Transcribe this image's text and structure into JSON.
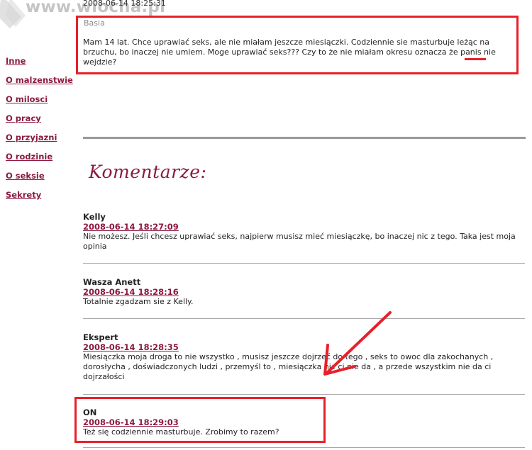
{
  "watermark": {
    "text": "www.wiocha.pl"
  },
  "post": {
    "date": "2008-06-14 18:25:31",
    "author": "Basia",
    "text": "Mam 14 lat. Chce uprawiać seks, ale nie miałam jeszcze miesiączki. Codziennie sie masturbuje leżąc na brzuchu, bo inaczej nie umiem. Moge uprawiać seks??? Czy to że nie miałam okresu oznacza że panis nie wejdzie?"
  },
  "sidebar": {
    "items": [
      {
        "label": "Inne"
      },
      {
        "label": "O malzenstwie"
      },
      {
        "label": "O milosci"
      },
      {
        "label": "O pracy"
      },
      {
        "label": "O przyjazni"
      },
      {
        "label": "O rodzinie"
      },
      {
        "label": "O seksie"
      },
      {
        "label": "Sekrety"
      }
    ]
  },
  "comments_title": "Komentarze:",
  "comments": [
    {
      "author": "Kelly",
      "date": "2008-06-14 18:27:09",
      "text": "Nie możesz. Jeśli chcesz uprawiać seks, najpierw musisz mieć miesiączkę, bo inaczej nic z tego. Taka jest moja opinia"
    },
    {
      "author": "Wasza Anett",
      "date": "2008-06-14 18:28:16",
      "text": "Totalnie zgadzam sie z Kelly."
    },
    {
      "author": "Ekspert",
      "date": "2008-06-14 18:28:35",
      "text": "Miesiączka moja droga to nie wszystko , musisz jeszcze dojrzeć do tego , seks to owoc dla zakochanych , dorosłycha , doświadczonych ludzi , przemyśl to , miesiączka nic ci nie da , a przede wszystkim nie da ci dojrzałości"
    },
    {
      "author": "ON",
      "date": "2008-06-14 18:29:03",
      "text": "Też się codziennie masturbuje. Zrobimy to razem?"
    }
  ],
  "colors": {
    "link": "#8c1a3e",
    "highlight": "#e8202a"
  }
}
